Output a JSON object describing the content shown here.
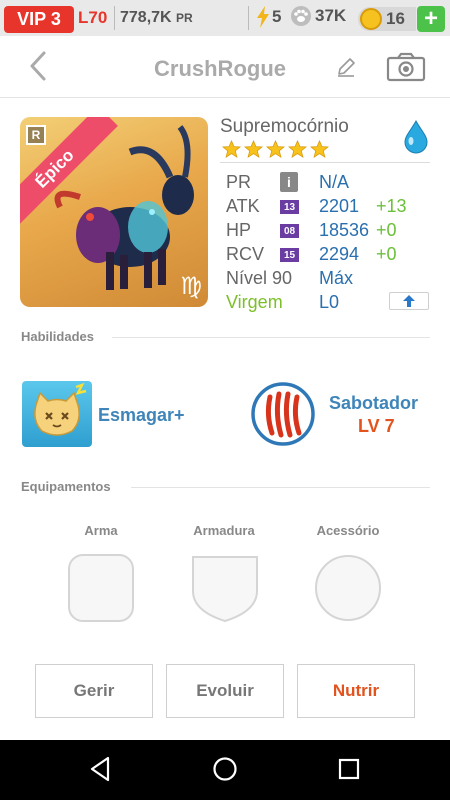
{
  "status_bar": {
    "vip": "VIP 3",
    "level": "L70",
    "power": "778,7K",
    "power_unit": "PR",
    "energy": "5",
    "paws": "37K",
    "coins": "16",
    "plus": "+"
  },
  "header": {
    "title": "CrushRogue"
  },
  "monster": {
    "rarity_badge": "R",
    "rarity_ribbon": "Épico",
    "zodiac_symbol": "♍",
    "name": "Supremocórnio",
    "stars": 5,
    "element_color": "#2aa8e0",
    "stats": [
      {
        "label": "PR",
        "value": "N/A",
        "plus": ""
      },
      {
        "label": "ATK",
        "lv": "13",
        "value": "2201",
        "plus": "+13"
      },
      {
        "label": "HP",
        "lv": "08",
        "value": "18536",
        "plus": "+0"
      },
      {
        "label": "RCV",
        "lv": "15",
        "value": "2294",
        "plus": "+0"
      }
    ],
    "level_label": "Nível 90",
    "level_value": "Máx",
    "sign_label": "Virgem",
    "sign_value": "L0"
  },
  "abilities": {
    "title": "Habilidades",
    "skill_name": "Esmagar+",
    "leader_name": "Sabotador",
    "leader_level": "LV 7"
  },
  "equipment": {
    "title": "Equipamentos",
    "weapon": "Arma",
    "armor": "Armadura",
    "accessory": "Acessório"
  },
  "actions": {
    "manage": "Gerir",
    "evolve": "Evoluir",
    "feed": "Nutrir"
  },
  "colors": {
    "accent_red": "#e8352b",
    "stat_blue": "#2a6fae",
    "plus_green": "#6bbf3b",
    "sign_green": "#7cbf2a",
    "feed_orange": "#e2531e"
  }
}
